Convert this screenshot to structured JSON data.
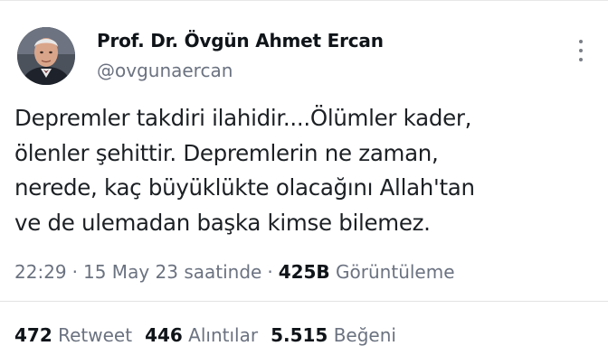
{
  "author": {
    "name": "Prof. Dr. Övgün Ahmet Ercan",
    "handle": "@ovgunaercan"
  },
  "tweet": {
    "text": "Depremler takdiri ilahidir....Ölümler kader,\nölenler şehittir. Depremlerin ne zaman,\nnerede, kaç büyüklükte olacağını Allah'tan\nve de ulemadan başka kimse bilemez."
  },
  "meta": {
    "time": "22:29",
    "separator": "·",
    "date": "15 May 23 saatinde",
    "views_count": "425B",
    "views_label": "Görüntüleme"
  },
  "stats": {
    "retweets_count": "472",
    "retweets_label": "Retweet",
    "quotes_count": "446",
    "quotes_label": "Alıntılar",
    "likes_count": "5.515",
    "likes_label": "Beğeni"
  },
  "icons": {
    "more": "more-options-icon"
  }
}
